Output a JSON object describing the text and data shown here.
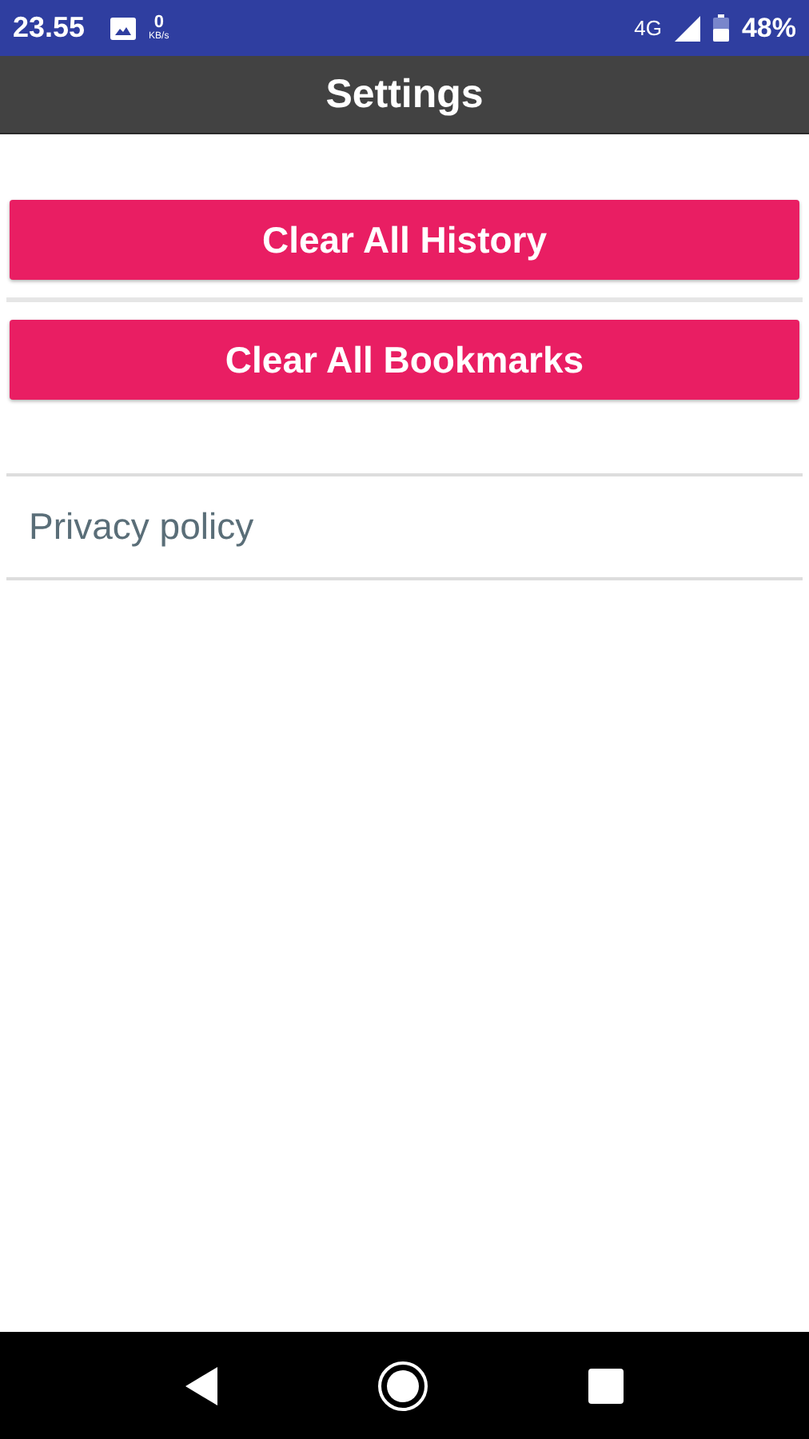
{
  "status_bar": {
    "time": "23.55",
    "speed": "0",
    "speed_unit": "KB/s",
    "network": "4G",
    "battery": "48%"
  },
  "app_bar": {
    "title": "Settings"
  },
  "buttons": [
    {
      "label": "Clear All History"
    },
    {
      "label": "Clear All Bookmarks"
    }
  ],
  "links": [
    {
      "label": "Privacy policy"
    }
  ]
}
